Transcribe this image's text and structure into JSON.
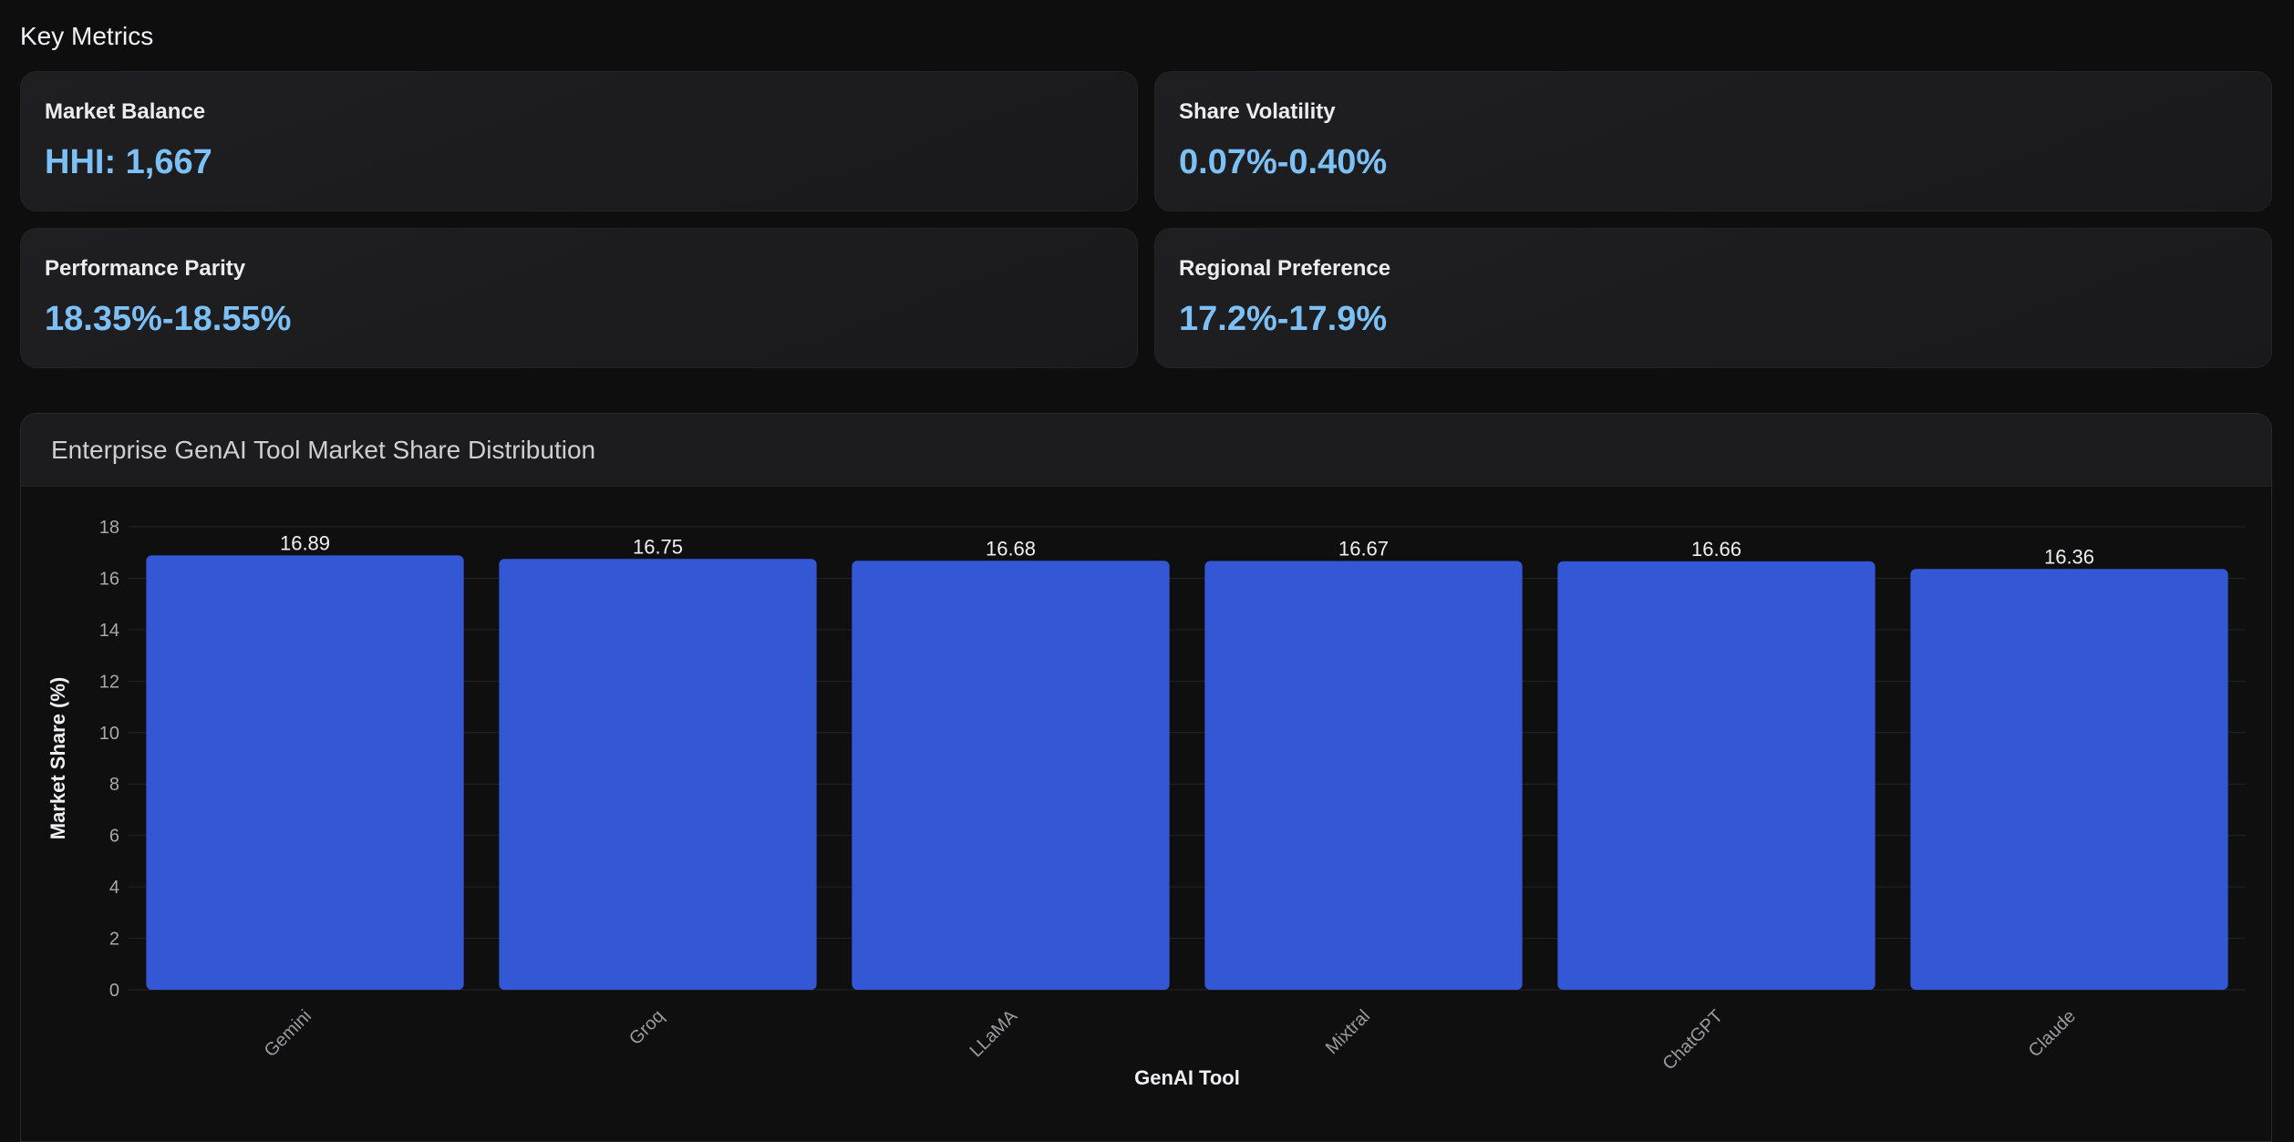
{
  "section_title": "Key Metrics",
  "metrics": [
    {
      "label": "Market Balance",
      "value": "HHI: 1,667"
    },
    {
      "label": "Share Volatility",
      "value": "0.07%-0.40%"
    },
    {
      "label": "Performance Parity",
      "value": "18.35%-18.55%"
    },
    {
      "label": "Regional Preference",
      "value": "17.2%-17.9%"
    }
  ],
  "colors": {
    "bar": "#3457d5",
    "accent_value": "#7cc0f5",
    "background": "#0e0e0f"
  },
  "chart_data": {
    "type": "bar",
    "title": "Enterprise GenAI Tool Market Share Distribution",
    "xlabel": "GenAI Tool",
    "ylabel": "Market Share (%)",
    "categories": [
      "Gemini",
      "Groq",
      "LLaMA",
      "Mixtral",
      "ChatGPT",
      "Claude"
    ],
    "values": [
      16.89,
      16.75,
      16.68,
      16.67,
      16.66,
      16.36
    ],
    "value_labels": [
      "16.89",
      "16.75",
      "16.68",
      "16.67",
      "16.66",
      "16.36"
    ],
    "ylim": [
      0,
      18
    ],
    "yticks": [
      0,
      2,
      4,
      6,
      8,
      10,
      12,
      14,
      16,
      18
    ],
    "grid": true,
    "legend": "none"
  }
}
